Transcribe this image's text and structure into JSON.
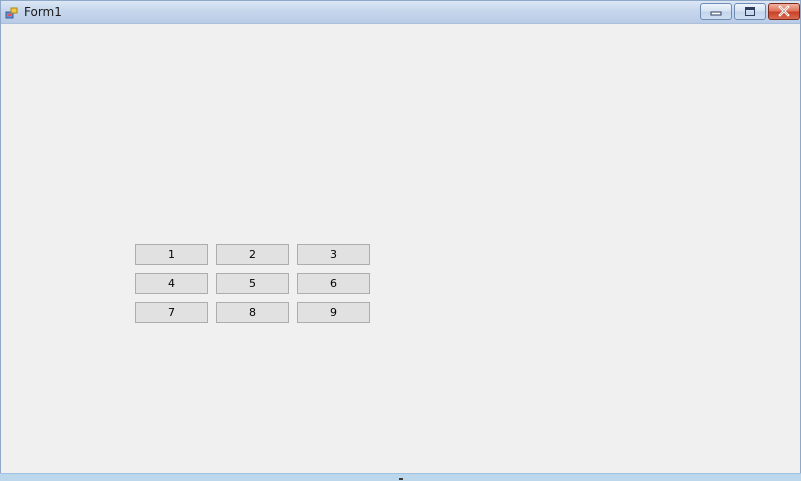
{
  "window": {
    "title": "Form1",
    "minimize_icon": "minimize-icon",
    "maximize_icon": "maximize-icon",
    "close_icon": "close-icon"
  },
  "keypad": {
    "buttons": [
      "1",
      "2",
      "3",
      "4",
      "5",
      "6",
      "7",
      "8",
      "9"
    ]
  },
  "colors": {
    "form_background": "#f0f0f0",
    "button_face": "#e1e1e1",
    "button_border": "#adadad",
    "close_button": "#c9412a"
  }
}
